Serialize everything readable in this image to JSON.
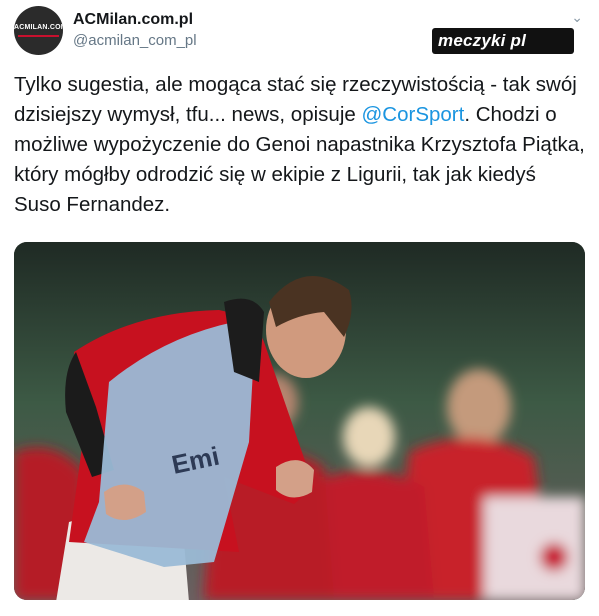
{
  "account": {
    "name": "ACMilan.com.pl",
    "handle": "@acmilan_com_pl",
    "avatar_text": "ACMILAN.COM.PL"
  },
  "watermark": "meczyki pl",
  "tweet": {
    "before_mention": "Tylko sugestia, ale mogąca stać się rzeczywistością - tak swój dzisiejszy wymysł, tfu... news, opisuje ",
    "mention": "@CorSport",
    "after_mention": ". Chodzi o możliwe wypożyczenie do Genoi napastnika Krzysztofa Piątka, który mógłby odrodzić się w ekipie z Ligurii, tak jak kiedyś Suso Fernandez."
  },
  "photo": {
    "description_icon": "photo-image",
    "bib_text": "Emi"
  },
  "colors": {
    "mention": "#1b95e0",
    "handle": "#657786",
    "milan_red": "#c8102e"
  }
}
